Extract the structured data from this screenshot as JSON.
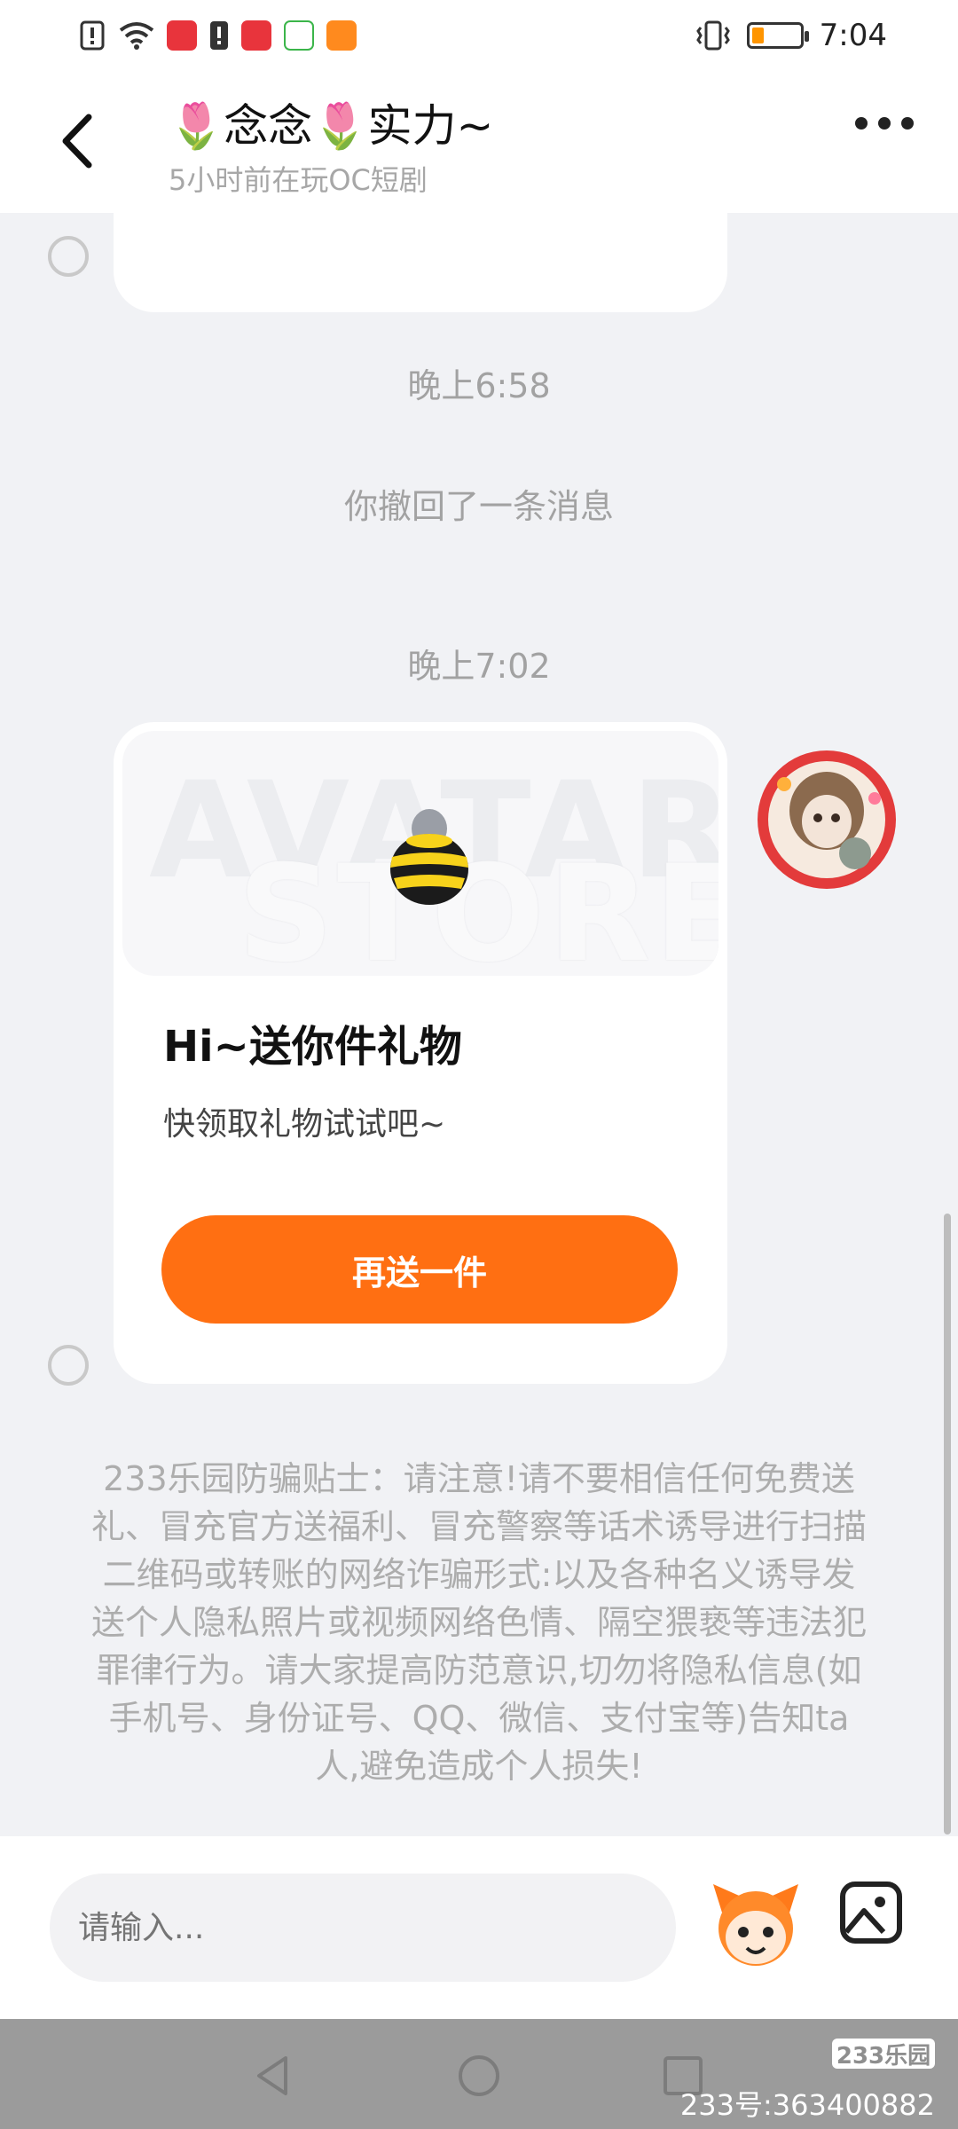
{
  "status_bar": {
    "time": "7:04",
    "battery_level": 0.25,
    "icons": [
      "alert-icon",
      "wifi-icon",
      "huawei-app-icon",
      "sim-alert-icon",
      "huawei-app-icon",
      "app-100-icon",
      "video-app-icon",
      "vibrate-icon",
      "battery-icon"
    ]
  },
  "header": {
    "title": "🌷念念🌷实力~",
    "subtitle": "5小时前在玩OC短剧",
    "back_icon": "chevron-left-icon",
    "more_icon": "more-dots-icon"
  },
  "chat": {
    "timestamps": [
      "晚上6:58",
      "晚上7:02"
    ],
    "system_message": "你撤回了一条消息",
    "gift_card": {
      "watermark_line1": "AVATAR",
      "watermark_line2": "STORE",
      "title": "Hi~送你件礼物",
      "subtitle": "快领取礼物试试吧~",
      "button_label": "再送一件"
    },
    "warning": "233乐园防骗贴士：请注意!请不要相信任何免费送礼、冒充官方送福利、冒充警察等话术诱导进行扫描二维码或转账的网络诈骗形式:以及各种名义诱导发送个人隐私照片或视频网络色情、隔空猥亵等违法犯罪律行为。请大家提高防范意识,切勿将隐私信息(如手机号、身份证号、QQ、微信、支付宝等)告知ta人,避免造成个人损失!"
  },
  "input_bar": {
    "placeholder": "请输入...",
    "emoji_icon": "emoji-mascot-icon",
    "image_icon": "image-icon"
  },
  "nav_bar": {
    "brand": "233乐园",
    "user_id": "233号:363400882"
  },
  "colors": {
    "accent": "#ff6f12",
    "background": "#f1f2f5",
    "muted_text": "#a2a2a2"
  }
}
